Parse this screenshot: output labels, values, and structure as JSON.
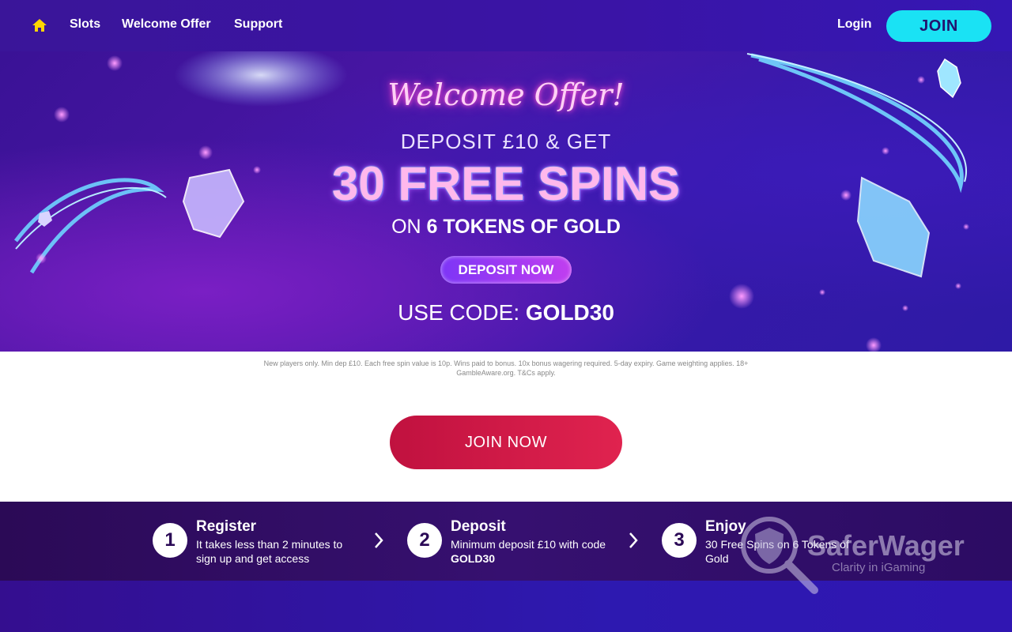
{
  "nav": {
    "home_icon": "home-icon",
    "links": [
      "Slots",
      "Welcome Offer",
      "Support"
    ],
    "login": "Login",
    "join": "JOIN",
    "colors": {
      "join_bg": "#1ae2f4",
      "home_icon": "#ffd500"
    }
  },
  "hero": {
    "title": "Welcome Offer!",
    "deposit_line": "DEPOSIT £10 & GET",
    "spins_line": "30 FREE SPINS",
    "on_prefix": "ON",
    "game": "6 TOKENS OF GOLD",
    "button": "DEPOSIT NOW",
    "code_prefix": "USE CODE:",
    "code": "GOLD30"
  },
  "terms": "New players only. Min dep £10. Each free spin value is 10p. Wins paid to bonus. 10x bonus wagering required. 5-day expiry. Game weighting applies. 18+ GambleAware.org. T&Cs apply.",
  "join_now": "JOIN NOW",
  "steps": [
    {
      "number": "1",
      "title": "Register",
      "text": "It takes less than 2 minutes to sign up and get access"
    },
    {
      "number": "2",
      "title": "Deposit",
      "text_prefix": "Minimum deposit £10 with code ",
      "text_code": "GOLD30"
    },
    {
      "number": "3",
      "title": "Enjoy",
      "text": "30 Free Spins on 6 Tokens of Gold"
    }
  ],
  "watermark": {
    "brand": "SaferWager",
    "tagline": "Clarity in iGaming"
  }
}
